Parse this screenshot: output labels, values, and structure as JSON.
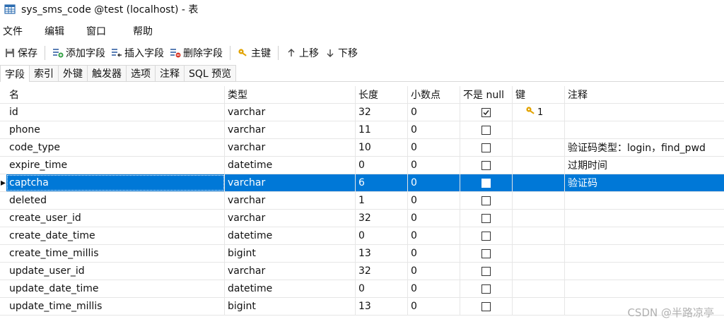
{
  "window": {
    "title": "sys_sms_code @test (localhost) - 表"
  },
  "menu": [
    "文件",
    "编辑",
    "窗口",
    "帮助"
  ],
  "toolbar": {
    "save": "保存",
    "add_field": "添加字段",
    "insert_field": "插入字段",
    "delete_field": "删除字段",
    "primary_key": "主键",
    "move_up": "上移",
    "move_down": "下移"
  },
  "tabs": [
    "字段",
    "索引",
    "外键",
    "触发器",
    "选项",
    "注释",
    "SQL 预览"
  ],
  "grid": {
    "headers": [
      "名",
      "类型",
      "长度",
      "小数点",
      "不是 null",
      "键",
      "注释"
    ],
    "rows": [
      {
        "name": "id",
        "type": "varchar",
        "length": "32",
        "decimals": "0",
        "not_null": true,
        "key": "1",
        "comment": ""
      },
      {
        "name": "phone",
        "type": "varchar",
        "length": "11",
        "decimals": "0",
        "not_null": false,
        "key": "",
        "comment": ""
      },
      {
        "name": "code_type",
        "type": "varchar",
        "length": "10",
        "decimals": "0",
        "not_null": false,
        "key": "",
        "comment": "验证码类型：login，find_pwd"
      },
      {
        "name": "expire_time",
        "type": "datetime",
        "length": "0",
        "decimals": "0",
        "not_null": false,
        "key": "",
        "comment": "过期时间"
      },
      {
        "name": "captcha",
        "type": "varchar",
        "length": "6",
        "decimals": "0",
        "not_null": false,
        "key": "",
        "comment": "验证码"
      },
      {
        "name": "deleted",
        "type": "varchar",
        "length": "1",
        "decimals": "0",
        "not_null": false,
        "key": "",
        "comment": ""
      },
      {
        "name": "create_user_id",
        "type": "varchar",
        "length": "32",
        "decimals": "0",
        "not_null": false,
        "key": "",
        "comment": ""
      },
      {
        "name": "create_date_time",
        "type": "datetime",
        "length": "0",
        "decimals": "0",
        "not_null": false,
        "key": "",
        "comment": ""
      },
      {
        "name": "create_time_millis",
        "type": "bigint",
        "length": "13",
        "decimals": "0",
        "not_null": false,
        "key": "",
        "comment": ""
      },
      {
        "name": "update_user_id",
        "type": "varchar",
        "length": "32",
        "decimals": "0",
        "not_null": false,
        "key": "",
        "comment": ""
      },
      {
        "name": "update_date_time",
        "type": "datetime",
        "length": "0",
        "decimals": "0",
        "not_null": false,
        "key": "",
        "comment": ""
      },
      {
        "name": "update_time_millis",
        "type": "bigint",
        "length": "13",
        "decimals": "0",
        "not_null": false,
        "key": "",
        "comment": ""
      }
    ],
    "selected_row": 4,
    "row_indicator": "▸"
  },
  "watermark": "CSDN @半路凉亭",
  "colors": {
    "selection": "#0078d7",
    "key_icon": "#e2a300"
  }
}
